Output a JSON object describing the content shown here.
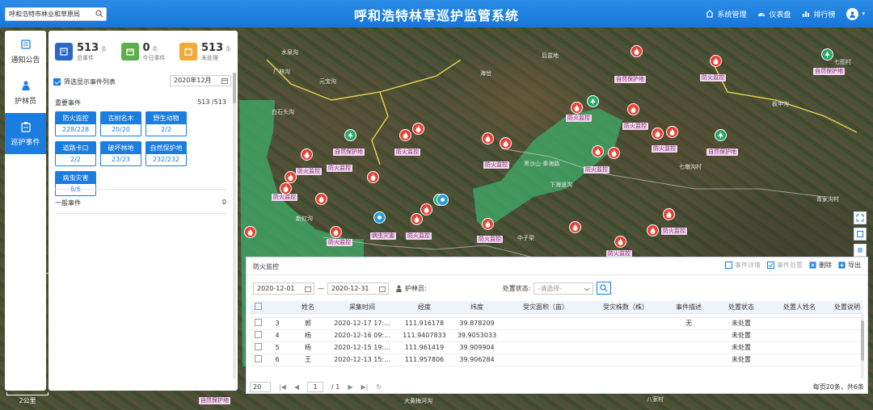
{
  "header": {
    "search_value": "呼和浩特市林业和草原局",
    "title": "呼和浩特林草巡护监管系统",
    "nav": [
      {
        "label": "系统管理",
        "icon": "home-icon"
      },
      {
        "label": "仪表盘",
        "icon": "dashboard-icon"
      },
      {
        "label": "排行榜",
        "icon": "ranking-icon"
      }
    ]
  },
  "sidebar": {
    "items": [
      {
        "label": "通知公告",
        "icon": "notice-icon"
      },
      {
        "label": "护林员",
        "icon": "ranger-icon"
      },
      {
        "label": "巡护事件",
        "icon": "patrol-event-icon",
        "active": true
      }
    ]
  },
  "panel": {
    "stats": [
      {
        "value": "513",
        "unit": "条",
        "label": "总事件",
        "color": "#2b66c8"
      },
      {
        "value": "0",
        "unit": "条",
        "label": "今日事件",
        "color": "#5aae4c"
      },
      {
        "value": "513",
        "unit": "条",
        "label": "未处理",
        "color": "#f2a93b"
      }
    ],
    "filter_label": "筛选显示事件列表",
    "month": "2020年12月",
    "important_title": "重要事件",
    "important_count": "513 /513",
    "categories": [
      {
        "name": "防火监控",
        "count": "228/228"
      },
      {
        "name": "古树名木",
        "count": "20/20"
      },
      {
        "name": "野生动物",
        "count": "2/2"
      },
      {
        "name": "道路卡口",
        "count": "2/2"
      },
      {
        "name": "破坏林地",
        "count": "23/23"
      },
      {
        "name": "自然保护地",
        "count": "232/232"
      },
      {
        "name": "病虫灾害",
        "count": "6/6"
      }
    ],
    "general_title": "一般事件",
    "general_count": "0"
  },
  "map": {
    "scale": "2公里",
    "places": [
      "水泉沟",
      "厂林沟",
      "元宝沟",
      "后盆地",
      "海岔",
      "白石头沟",
      "黑沙山·秦海路",
      "下海道沟",
      "板申沟",
      "七墩沟村",
      "青家沟村",
      "七图村",
      "新虹沟",
      "中子梁",
      "大黄梅河沟",
      "八家村"
    ],
    "tag_fire": "防火监控",
    "tag_reserve": "自然保护地",
    "tag_pest": "病虫灾害"
  },
  "table_panel": {
    "title": "防火监控",
    "actions": [
      {
        "label": "事件详情",
        "enabled": false
      },
      {
        "label": "事件处置",
        "enabled": false
      },
      {
        "label": "删除",
        "enabled": true
      },
      {
        "label": "导出",
        "enabled": true
      }
    ],
    "date_from": "2020-12-01",
    "date_to": "2020-12-31",
    "ranger_label": "护林员:",
    "status_label": "处置状态:",
    "status_placeholder": "-请选择-",
    "columns": [
      "",
      "姓名",
      "采集时间",
      "经度",
      "纬度",
      "受灾面积（亩）",
      "受灾株数（株）",
      "事件描述",
      "处置状态",
      "处置人姓名",
      "处置说明"
    ],
    "rows": [
      [
        "3",
        "郭",
        "2020-12-17 17:...",
        "111.916178",
        "39.878209",
        "",
        "",
        "无",
        "未处置",
        "",
        ""
      ],
      [
        "4",
        "杨",
        "2020-12-16 09:...",
        "111.9407833",
        "39.9053033",
        "",
        "",
        "",
        "未处置",
        "",
        ""
      ],
      [
        "5",
        "杨",
        "2020-12-15 19:...",
        "111.961419",
        "39.909904",
        "",
        "",
        "",
        "未处置",
        "",
        ""
      ],
      [
        "6",
        "王",
        "2020-12-13 15:...",
        "111.957806",
        "39.906284",
        "",
        "",
        "",
        "未处置",
        "",
        ""
      ]
    ],
    "page_size": "20",
    "page_current": "1",
    "page_total": "/ 1",
    "total_text": "每页20条，共6条"
  }
}
